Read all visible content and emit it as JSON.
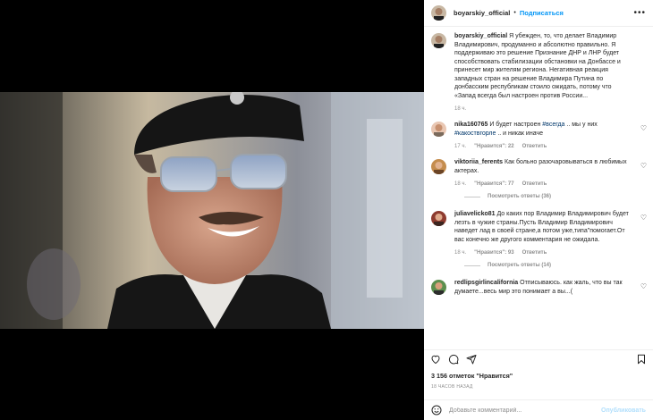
{
  "post": {
    "author": "boyarskiy_official",
    "follow_label": "Подписаться",
    "more_label": "•••",
    "caption_author": "boyarskiy_official",
    "caption_text": "Я убежден, то, что делает Владимир Владимирович, продуманно и абсолютно правильно. Я поддерживаю это решение Признание ДНР и ЛНР будет способствовать стабилизации обстановки на Донбассе и принесет мир жителям региона. Негативная реакция западных стран на решение Владимира Путина по донбасским республикам стоило ожидать, потому что «Запад всегда был настроен против России...",
    "caption_time": "18 ч."
  },
  "comments": [
    {
      "user": "nika160765",
      "text_before": "И будет настроен ",
      "tag1": "#всегда",
      "text_mid": " .. мы у них ",
      "tag2": "#какоствгорле",
      "text_after": " .. и никак иначе",
      "time": "17 ч.",
      "likes": "\"Нравится\": 22",
      "reply": "Ответить"
    },
    {
      "user": "viktoriia_ferents",
      "text": "Как больно разочаровываться в любимых актерах.",
      "time": "18 ч.",
      "likes": "\"Нравится\": 77",
      "reply": "Ответить",
      "replies_label": "Посмотреть ответы (36)"
    },
    {
      "user": "juliavelicko81",
      "text": "До каких пор Владимир Владимирович будет лезть в чужие страны.Пусть Владимир Владимирович наведет лад в своей стране,а потом уже,типа\"помогает.От вас конечно же другого комментария не ожидала.",
      "time": "18 ч.",
      "likes": "\"Нравится\": 93",
      "reply": "Ответить",
      "replies_label": "Посмотреть ответы (14)"
    },
    {
      "user": "redlipsgirlincalifornia",
      "text": "Отписываюсь. как жаль, что вы так думаете...весь мир это понимает а вы...(",
      "time": "",
      "likes": "",
      "reply": ""
    }
  ],
  "likes_count": "3 156 отметок \"Нравится\"",
  "post_time": "18 ЧАСОВ НАЗАД",
  "add_comment": {
    "placeholder": "Добавьте комментарий...",
    "publish_label": "Опубликовать"
  },
  "icons": [
    "heart-icon",
    "comment-icon",
    "share-icon",
    "bookmark-icon",
    "emoji-icon",
    "more-icon"
  ],
  "colors": {
    "accent": "#0095f6",
    "publish_disabled": "#b2dffc",
    "secondary_text": "#8e8e8e",
    "hashtag": "#00376b"
  }
}
